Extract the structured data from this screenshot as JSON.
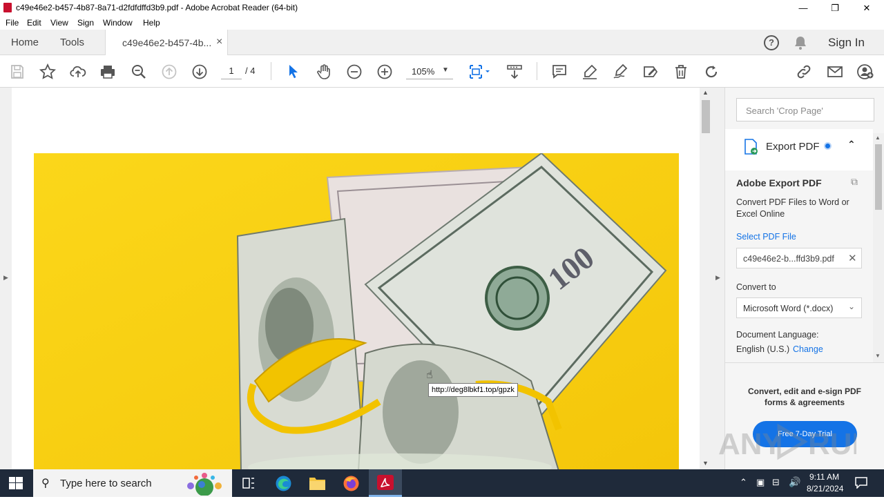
{
  "window": {
    "title": "c49e46e2-b457-4b87-8a71-d2fdfdffd3b9.pdf - Adobe Acrobat Reader (64-bit)",
    "minimize": "—",
    "maximize": "❐",
    "close": "✕"
  },
  "menu": [
    "File",
    "Edit",
    "View",
    "Sign",
    "Window",
    "Help"
  ],
  "tabs": {
    "home": "Home",
    "tools": "Tools",
    "document": "c49e46e2-b457-4b...",
    "close": "×",
    "sign_in": "Sign In"
  },
  "toolbar": {
    "page_current": "1",
    "page_total": "/ 4",
    "zoom": "105%"
  },
  "document": {
    "tooltip": "http://deg8lbkf1.top/gpzk",
    "image_description_icon": "money-roll-image"
  },
  "right_panel": {
    "search_placeholder": "Search 'Crop Page'",
    "export_title": "Export PDF",
    "adobe_export_title": "Adobe Export PDF",
    "convert_desc": "Convert PDF Files to Word or Excel Online",
    "select_file_label": "Select PDF File",
    "file_name": "c49e46e2-b...ffd3b9.pdf",
    "convert_to_label": "Convert to",
    "convert_to_value": "Microsoft Word (*.docx)",
    "doc_language_label": "Document Language:",
    "doc_language_value": "English (U.S.)",
    "change_link": "Change",
    "promo_text": "Convert, edit and e-sign PDF forms & agreements",
    "trial_button": "Free 7-Day Trial"
  },
  "taskbar": {
    "search_placeholder": "Type here to search",
    "time": "9:11 AM",
    "date": "8/21/2024"
  },
  "colors": {
    "accent_blue": "#1473e6",
    "pdf_red": "#c8102e",
    "image_yellow": "#f7d010",
    "taskbar": "#1f2a3a"
  }
}
